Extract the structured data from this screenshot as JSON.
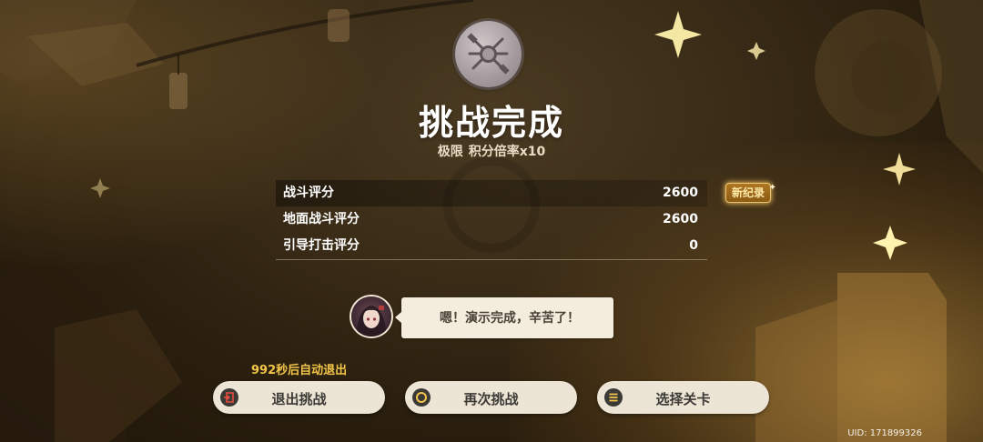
{
  "header": {
    "title": "挑战完成",
    "difficulty": "极限",
    "multiplier": "积分倍率x10"
  },
  "scores": [
    {
      "label": "战斗评分",
      "value": "2600"
    },
    {
      "label": "地面战斗评分",
      "value": "2600"
    },
    {
      "label": "引导打击评分",
      "value": "0"
    }
  ],
  "new_record_badge": "新纪录",
  "dialog": {
    "text": "嗯！演示完成，辛苦了！"
  },
  "countdown": "992秒后自动退出",
  "buttons": {
    "exit": "退出挑战",
    "retry": "再次挑战",
    "select": "选择关卡"
  },
  "uid": "UID: 171899326",
  "colors": {
    "accent_gold": "#f2c54a",
    "button_bg": "#ece4d4",
    "badge_bg": "#8a5a14"
  },
  "icons": {
    "exit": "exit-door-icon",
    "retry": "circle-icon",
    "select": "list-menu-icon",
    "emblem": "crossed-tools-emblem"
  }
}
